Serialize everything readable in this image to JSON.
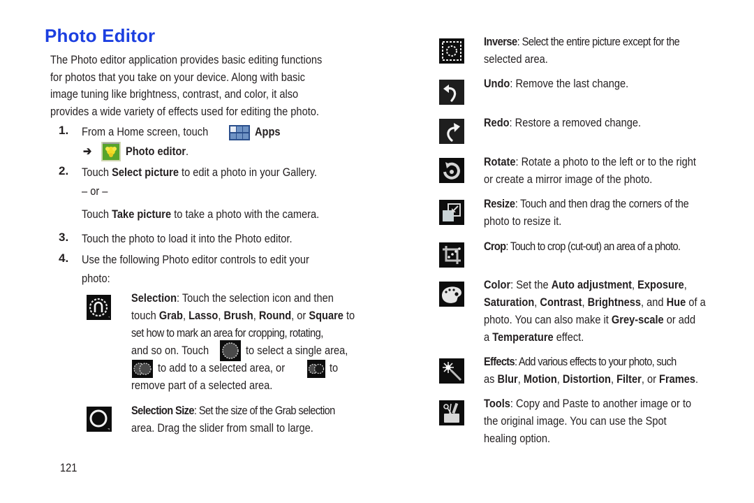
{
  "page": {
    "title": "Photo Editor",
    "intro": "The Photo editor application provides basic editing functions for photos that you take on your device. Along with basic image tuning like brightness, contrast, and color, it also provides a wide variety of effects used for editing the photo.",
    "page_number": "121"
  },
  "steps": [
    {
      "num": "1.",
      "pre": "From a Home screen, touch",
      "apps_label": "Apps",
      "arrow": "➔",
      "photo_editor_label": "Photo editor",
      "end": "."
    },
    {
      "num": "2.",
      "pre": "Touch ",
      "bold": "Select picture",
      "post": " to edit a photo in your Gallery.",
      "or": "– or –",
      "alt_pre": "Touch ",
      "alt_bold": "Take picture",
      "alt_post": " to take a photo with the camera."
    },
    {
      "num": "3.",
      "text": "Touch the photo to load it into the Photo editor."
    },
    {
      "num": "4.",
      "text_line1": "Use the following Photo editor controls to edit your",
      "text_line2": "photo:"
    }
  ],
  "left_controls": {
    "selection": {
      "icon": "selection-icon",
      "name": "Selection",
      "line1": ": Touch the selection icon and then",
      "line2_pre": "touch ",
      "grab": "Grab",
      "lasso": "Lasso",
      "brush": "Brush",
      "round": "Round",
      "or": ", or ",
      "square": "Square",
      "line2_post": " to",
      "line3": "set how to mark an area for cropping, rotating,",
      "line4_pre": "and so on. Touch",
      "line4_post": "to select a single area,",
      "line5_mid": "to add to a selected area, or",
      "line5_post": "to",
      "line6": "remove part of a selected area."
    },
    "selection_size": {
      "icon": "selection-size-icon",
      "name": "Selection Size",
      "line1": ": Set the size of the Grab selection",
      "line2": "area. Drag the slider from small to large."
    }
  },
  "right_controls": [
    {
      "icon": "inverse-icon",
      "name": "Inverse",
      "lines": [
        ": Select the entire picture except for the",
        "selected area."
      ]
    },
    {
      "icon": "undo-icon",
      "name": "Undo",
      "lines": [
        ": Remove the last change."
      ]
    },
    {
      "icon": "redo-icon",
      "name": "Redo",
      "lines": [
        ": Restore a removed change."
      ]
    },
    {
      "icon": "rotate-icon",
      "name": "Rotate",
      "lines": [
        ": Rotate a photo to the left or to the right",
        "or create a mirror image of the photo."
      ]
    },
    {
      "icon": "resize-icon",
      "name": "Resize",
      "lines": [
        ": Touch and then drag the corners of the",
        "photo to resize it."
      ]
    },
    {
      "icon": "crop-icon",
      "name": "Crop",
      "lines": [
        ": Touch to crop (cut-out) an area of a photo."
      ]
    }
  ],
  "color_control": {
    "icon": "palette-icon",
    "name": "Color",
    "l1_pre": ": Set the ",
    "auto": "Auto adjustment",
    "exposure": "Exposure",
    "saturation": "Saturation",
    "contrast": "Contrast",
    "brightness": "Brightness",
    "and": ", and ",
    "hue": "Hue",
    "of_a": " of a",
    "l3_pre": "photo. You can also make it ",
    "grey": "Grey-scale",
    "l3_post": " or add",
    "l4_pre": "a ",
    "temperature": "Temperature",
    "l4_post": " effect."
  },
  "effects_control": {
    "icon": "magic-wand-icon",
    "name": "Effects",
    "l1": ": Add various effects to your photo, such",
    "l2_pre": "as ",
    "blur": "Blur",
    "motion": "Motion",
    "distortion": "Distortion",
    "filter": "Filter",
    "or": ", or ",
    "frames": "Frames",
    "end": "."
  },
  "tools_control": {
    "icon": "tools-icon",
    "name": "Tools",
    "lines": [
      ": Copy and Paste to another image or to",
      "the original image. You can use the Spot",
      "healing option."
    ]
  },
  "colors": {
    "title": "#1c3fe0",
    "text": "#231f20",
    "icon_bg": "#0d0d0d"
  }
}
